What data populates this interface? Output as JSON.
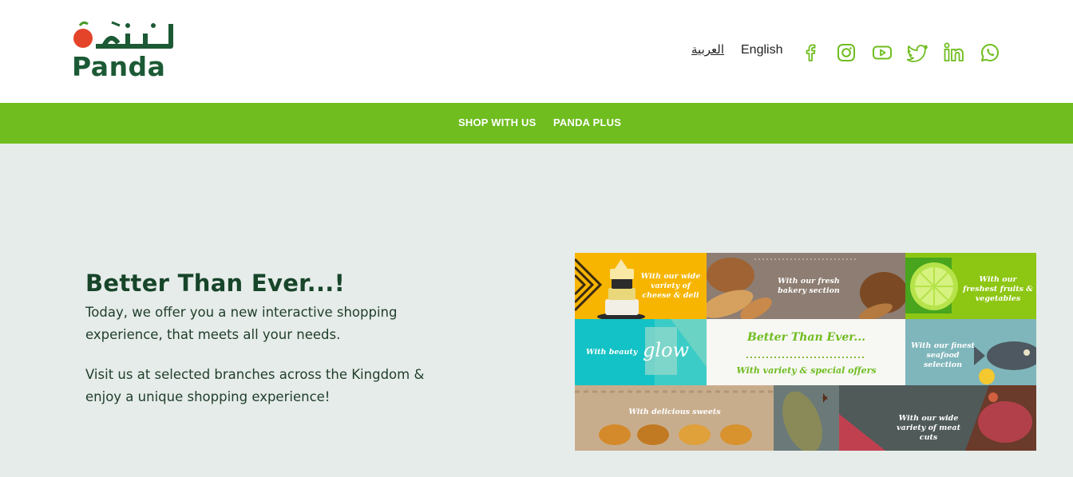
{
  "brand": {
    "arabic_name": "بندة",
    "name": "Panda"
  },
  "header": {
    "lang_arabic": "العربية",
    "lang_english": "English",
    "social": [
      "facebook-icon",
      "instagram-icon",
      "youtube-icon",
      "twitter-icon",
      "linkedin-icon",
      "whatsapp-icon"
    ]
  },
  "nav": {
    "items": [
      "SHOP WITH US",
      "PANDA PLUS"
    ]
  },
  "hero": {
    "title": "Better Than Ever...!",
    "paragraph1": "Today, we offer you a new interactive shopping experience, that meets all your needs.",
    "paragraph2": "Visit us at selected branches across the Kingdom & enjoy a unique shopping experience!"
  },
  "collage": {
    "cheese": "With our wide variety of cheese & deli",
    "bakery": "With our fresh bakery section",
    "fruits": "With our freshest fruits & vegetables",
    "beauty": "With beauty",
    "glow": "glow",
    "center_title": "Better Than Ever...",
    "center_sub": "With variety & special offers",
    "seafood": "With our finest seafood selection",
    "sweets": "With delicious sweets",
    "meat": "With our wide variety of meat cuts"
  },
  "colors": {
    "brand_green": "#6fbd1f",
    "dark_green": "#1c5a35",
    "logo_red": "#e4442a",
    "page_bg": "#e6ece9"
  }
}
